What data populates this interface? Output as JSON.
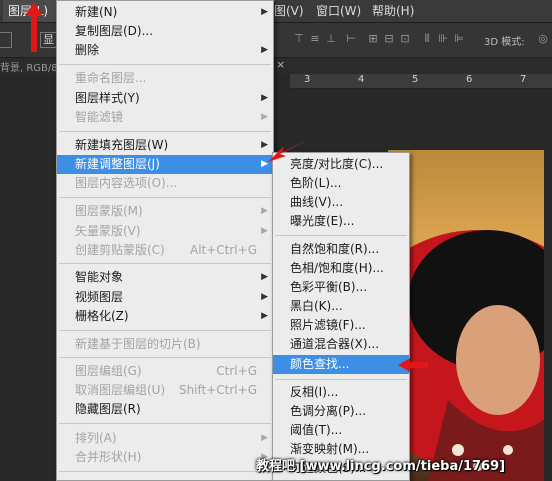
{
  "menubar": {
    "layer": "图层(L)",
    "view": "图(V)",
    "window": "窗口(W)",
    "help": "帮助(H)"
  },
  "optbar": {
    "display_btn": "显",
    "mode_3d": "3D 模式:"
  },
  "tabbar": {
    "doc_text": "背景, RGB/8",
    "close_glyph": "×"
  },
  "ruler": [
    "3",
    "4",
    "5",
    "6",
    "7"
  ],
  "layer_menu": [
    {
      "label": "新建(N)",
      "shortcut": "",
      "arrow": true,
      "disabled": false
    },
    {
      "label": "复制图层(D)...",
      "shortcut": "",
      "arrow": false,
      "disabled": false
    },
    {
      "label": "删除",
      "shortcut": "",
      "arrow": true,
      "disabled": false
    },
    {
      "label": "重命名图层...",
      "shortcut": "",
      "arrow": false,
      "disabled": true
    },
    {
      "label": "图层样式(Y)",
      "shortcut": "",
      "arrow": true,
      "disabled": false
    },
    {
      "label": "智能滤镜",
      "shortcut": "",
      "arrow": true,
      "disabled": true
    },
    {
      "label": "新建填充图层(W)",
      "shortcut": "",
      "arrow": true,
      "disabled": false
    },
    {
      "label": "新建调整图层(J)",
      "shortcut": "",
      "arrow": true,
      "disabled": false,
      "highlighted": true
    },
    {
      "label": "图层内容选项(O)...",
      "shortcut": "",
      "arrow": false,
      "disabled": true
    },
    {
      "label": "图层蒙版(M)",
      "shortcut": "",
      "arrow": true,
      "disabled": true
    },
    {
      "label": "矢量蒙版(V)",
      "shortcut": "",
      "arrow": true,
      "disabled": true
    },
    {
      "label": "创建剪贴蒙版(C)",
      "shortcut": "Alt+Ctrl+G",
      "arrow": false,
      "disabled": true
    },
    {
      "label": "智能对象",
      "shortcut": "",
      "arrow": true,
      "disabled": false
    },
    {
      "label": "视频图层",
      "shortcut": "",
      "arrow": true,
      "disabled": false
    },
    {
      "label": "栅格化(Z)",
      "shortcut": "",
      "arrow": true,
      "disabled": false
    },
    {
      "label": "新建基于图层的切片(B)",
      "shortcut": "",
      "arrow": false,
      "disabled": true
    },
    {
      "label": "图层编组(G)",
      "shortcut": "Ctrl+G",
      "arrow": false,
      "disabled": true
    },
    {
      "label": "取消图层编组(U)",
      "shortcut": "Shift+Ctrl+G",
      "arrow": false,
      "disabled": true
    },
    {
      "label": "隐藏图层(R)",
      "shortcut": "",
      "arrow": false,
      "disabled": false
    },
    {
      "label": "排列(A)",
      "shortcut": "",
      "arrow": true,
      "disabled": true
    },
    {
      "label": "合并形状(H)",
      "shortcut": "",
      "arrow": true,
      "disabled": true
    }
  ],
  "adjustment_menu": [
    {
      "label": "亮度/对比度(C)...",
      "highlighted": false
    },
    {
      "label": "色阶(L)...",
      "highlighted": false
    },
    {
      "label": "曲线(V)...",
      "highlighted": false
    },
    {
      "label": "曝光度(E)...",
      "highlighted": false
    },
    {
      "label": "自然饱和度(R)...",
      "highlighted": false
    },
    {
      "label": "色相/饱和度(H)...",
      "highlighted": false
    },
    {
      "label": "色彩平衡(B)...",
      "highlighted": false
    },
    {
      "label": "黑白(K)...",
      "highlighted": false
    },
    {
      "label": "照片滤镜(F)...",
      "highlighted": false
    },
    {
      "label": "通道混合器(X)...",
      "highlighted": false
    },
    {
      "label": "颜色查找...",
      "highlighted": true
    },
    {
      "label": "反相(I)...",
      "highlighted": false
    },
    {
      "label": "色调分离(P)...",
      "highlighted": false
    },
    {
      "label": "阈值(T)...",
      "highlighted": false
    },
    {
      "label": "渐变映射(M)...",
      "highlighted": false
    },
    {
      "label": "可选颜色(S)...",
      "highlighted": false
    }
  ],
  "watermark": "教程吧 [www.lincg.com/tieba/1769]",
  "colors": {
    "highlight": "#3d8fe6",
    "arrow": "#e21818",
    "menu_bg": "#ececec",
    "app_bg": "#282828"
  }
}
